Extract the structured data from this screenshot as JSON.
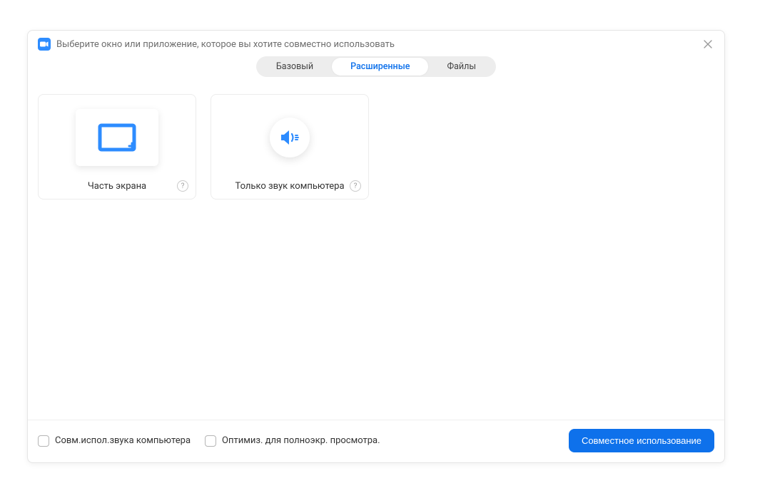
{
  "header": {
    "title": "Выберите окно или приложение, которое вы хотите совместно использовать"
  },
  "tabs": {
    "basic": "Базовый",
    "advanced": "Расширенные",
    "files": "Файлы"
  },
  "options": {
    "portion": {
      "label": "Часть экрана"
    },
    "audio_only": {
      "label": "Только звук компьютера"
    }
  },
  "footer": {
    "share_audio": "Совм.испол.звука компьютера",
    "optimize_fullscreen": "Оптимиз. для полноэкр. просмотра.",
    "share_button": "Совместное использование"
  }
}
